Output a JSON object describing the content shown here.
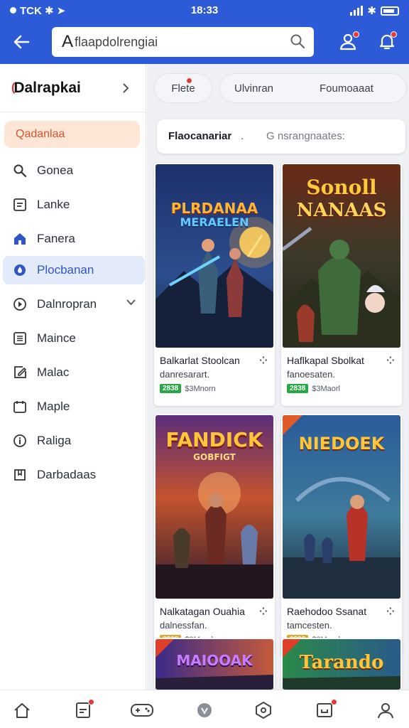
{
  "status_bar": {
    "carrier": "TCK",
    "time": "18:33"
  },
  "header": {
    "search_text": "flaapdolrengiai",
    "icons": [
      "back-arrow-icon",
      "search-icon",
      "user-icon",
      "notification-icon"
    ]
  },
  "sidebar": {
    "title": "Dalrapkai",
    "title_prefix": "(",
    "active_item": "Qadanlaa",
    "items": [
      {
        "label": "Gonea",
        "icon": "search-icon"
      },
      {
        "label": "Lanke",
        "icon": "list-icon"
      },
      {
        "label": "Fanera",
        "icon": "home-icon"
      },
      {
        "label": "Plocbanan",
        "icon": "drop-icon"
      },
      {
        "label": "Dalnropran",
        "icon": "compass-icon"
      },
      {
        "label": "Maince",
        "icon": "document-icon"
      },
      {
        "label": "Malac",
        "icon": "edit-icon"
      },
      {
        "label": "Maple",
        "icon": "calendar-icon"
      },
      {
        "label": "Raliga",
        "icon": "info-icon"
      },
      {
        "label": "Darbadaas",
        "icon": "bookmark-icon"
      }
    ]
  },
  "filters": {
    "chips": [
      "Flete",
      "Ulvinran",
      "Foumoaaat"
    ],
    "bar_label": "Flaocanariar",
    "bar_hint": "G nsrangnaates:"
  },
  "cards": [
    {
      "art_title": "PLRDANAA",
      "art_subtitle": "MERAELEN",
      "title": "Balkarlat Stoolcan",
      "subtitle": "danresarart.",
      "badge": "2838",
      "badge_color": "#27a845",
      "meta": "$3Mnorn"
    },
    {
      "art_title": "Sonoll",
      "art_subtitle": "NANAAS",
      "title": "Haflkapal Sbolkat",
      "subtitle": "fanoesaten.",
      "badge": "2838",
      "badge_color": "#27a845",
      "meta": "$3Maorl"
    },
    {
      "art_title": "FANDICK",
      "art_subtitle": "GOBFIGT",
      "title": "Nalkatagan Ouahia",
      "subtitle": "dalnessfan.",
      "badge": "2838",
      "badge_color": "#e6a51d",
      "meta": "$3Mnorl"
    },
    {
      "art_title": "NIEDOEK",
      "art_subtitle": "",
      "title": "Raehodoo Ssanat",
      "subtitle": "tamcesten.",
      "badge": "2838",
      "badge_color": "#e6a51d",
      "meta": "$3Maorl"
    },
    {
      "art_title": "MAIOOAK",
      "art_subtitle": ""
    },
    {
      "art_title": "Tarando",
      "art_subtitle": ""
    }
  ],
  "bottom_nav": [
    "home-icon",
    "document-icon",
    "game-controller-icon",
    "shield-icon",
    "store-icon",
    "inbox-icon",
    "profile-icon"
  ],
  "colors": {
    "primary": "#2d5ad6",
    "accent": "#d6562c",
    "notification": "#e23b3b"
  }
}
